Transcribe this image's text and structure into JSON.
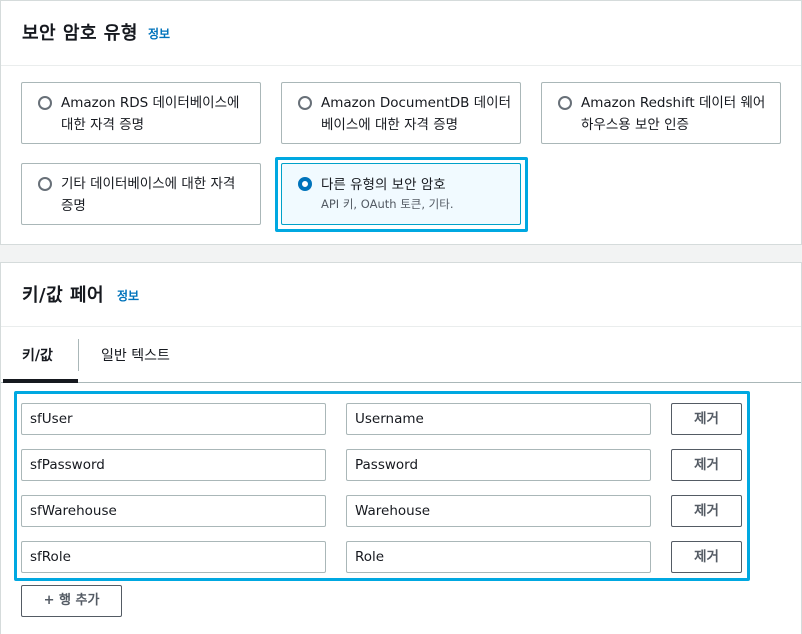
{
  "security_type": {
    "title": "보안 암호 유형",
    "info": "정보",
    "options": [
      {
        "label": "Amazon RDS 데이터베이스에 대한 자격 증명",
        "selected": false
      },
      {
        "label": "Amazon DocumentDB 데이터베이스에 대한 자격 증명",
        "selected": false
      },
      {
        "label": "Amazon Redshift 데이터 웨어하우스용 보안 인증",
        "selected": false
      },
      {
        "label": "기타 데이터베이스에 대한 자격 증명",
        "selected": false
      },
      {
        "label": "다른 유형의 보안 암호",
        "description": "API 키, OAuth 토큰, 기타.",
        "selected": true
      }
    ]
  },
  "kv": {
    "title": "키/값 페어",
    "info": "정보",
    "tabs": [
      {
        "label": "키/값",
        "active": true
      },
      {
        "label": "일반 텍스트",
        "active": false
      }
    ],
    "rows": [
      {
        "key": "sfUser",
        "value": "Username"
      },
      {
        "key": "sfPassword",
        "value": "Password"
      },
      {
        "key": "sfWarehouse",
        "value": "Warehouse"
      },
      {
        "key": "sfRole",
        "value": "Role"
      }
    ],
    "remove_label": "제거",
    "add_label": "+ 행 추가"
  },
  "colors": {
    "accent": "#0073bb",
    "highlight": "#00a8e1",
    "selected_bg": "#f1faff"
  }
}
